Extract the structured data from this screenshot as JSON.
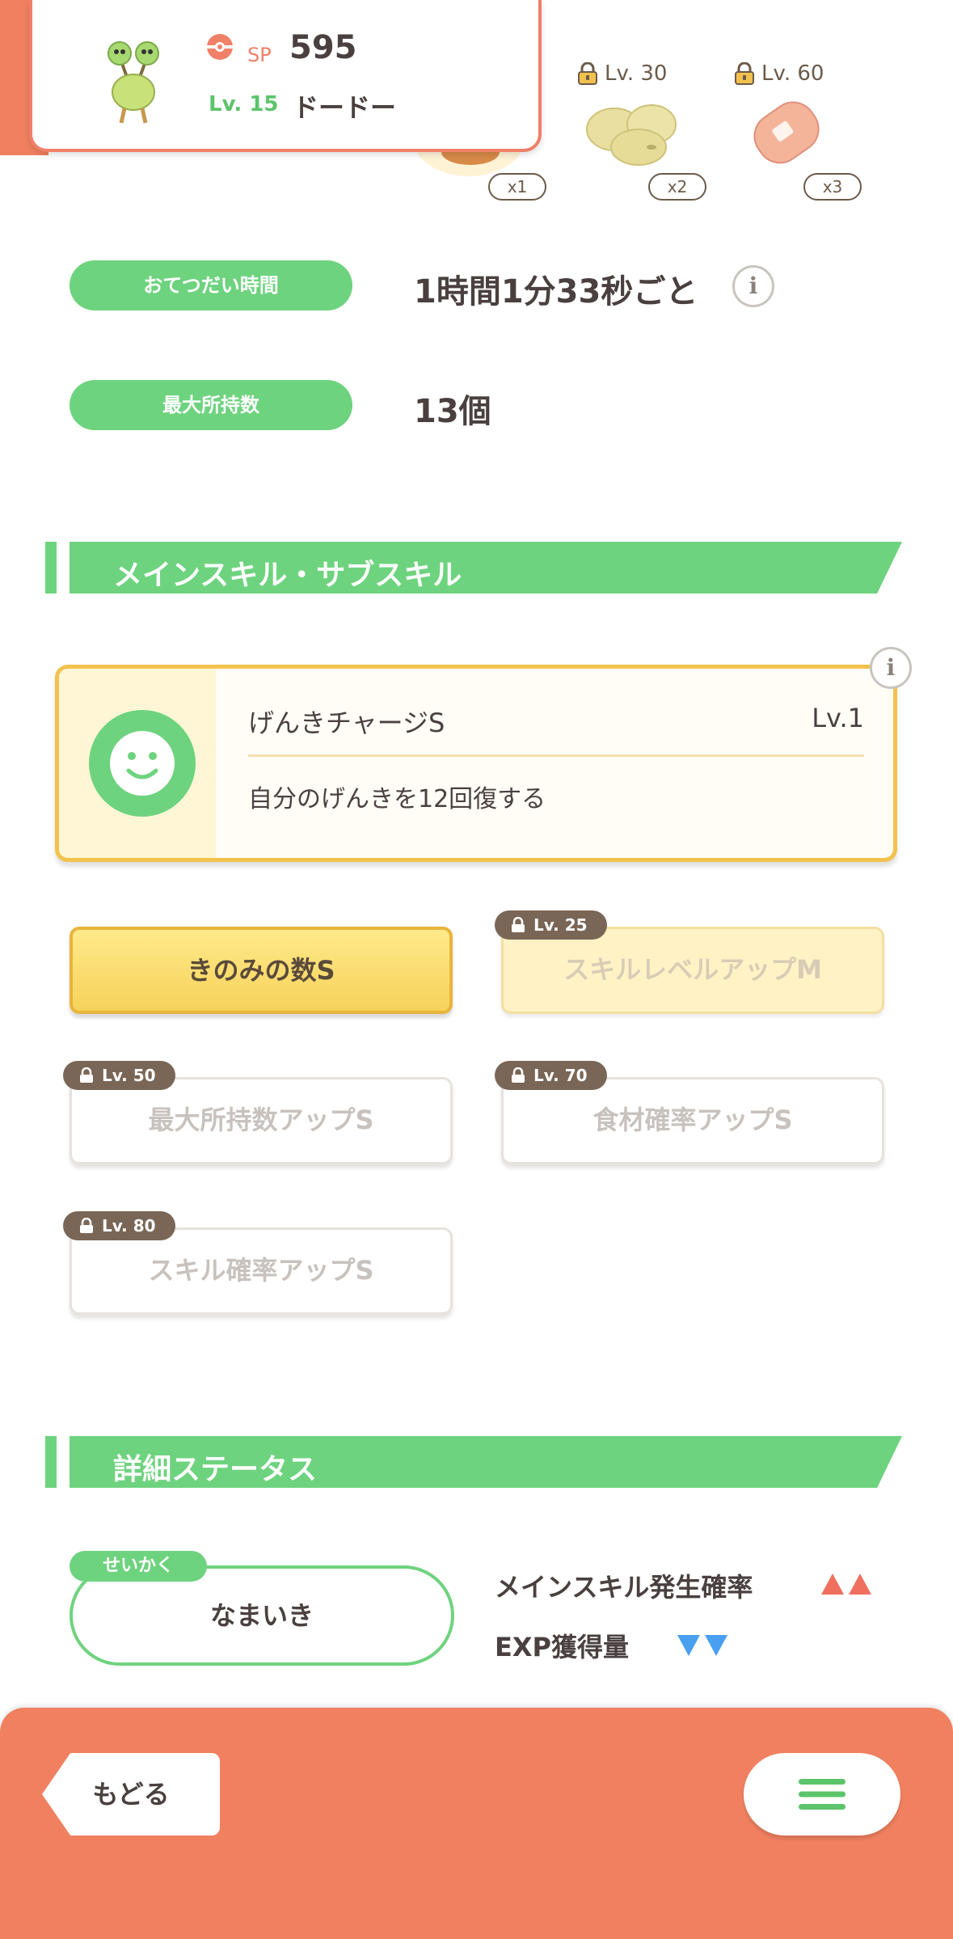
{
  "header": {
    "sp_label": "SP",
    "sp_value": "595",
    "level": "Lv. 15",
    "pokemon_name": "ドードー"
  },
  "ingredients": [
    {
      "count": "x1"
    },
    {
      "lock_level": "Lv. 30",
      "count": "x2"
    },
    {
      "lock_level": "Lv. 60",
      "count": "x3"
    }
  ],
  "info": {
    "help_time_label": "おてつだい時間",
    "help_time_value": "1時間1分33秒ごと",
    "info_button": "i",
    "max_carry_label": "最大所持数",
    "max_carry_value": "13個"
  },
  "skills_section": {
    "title": "メインスキル・サブスキル",
    "main_skill": {
      "name": "げんきチャージS",
      "level": "Lv.1",
      "description": "自分のげんきを12回復する"
    },
    "info_button": "i",
    "sub_skills": [
      {
        "label": "きのみの数S",
        "lock": ""
      },
      {
        "label": "スキルレベルアップM",
        "lock": "Lv. 25"
      },
      {
        "label": "最大所持数アップS",
        "lock": "Lv. 50"
      },
      {
        "label": "食材確率アップS",
        "lock": "Lv. 70"
      },
      {
        "label": "スキル確率アップS",
        "lock": "Lv. 80"
      }
    ]
  },
  "details_section": {
    "title": "詳細ステータス",
    "nature_tag": "せいかく",
    "nature_value": "なまいき",
    "effects": [
      {
        "label": "メインスキル発生確率",
        "direction": "up"
      },
      {
        "label": "EXP獲得量",
        "direction": "down"
      }
    ]
  },
  "bottom": {
    "back_label": "もどる",
    "menu_icon": "hamburger-menu-icon"
  },
  "colors": {
    "accent_green": "#6ed37e",
    "brand_coral": "#f08060",
    "skill_gold": "#f3c24e",
    "up_red": "#f07060",
    "down_blue": "#4aa0f0"
  }
}
